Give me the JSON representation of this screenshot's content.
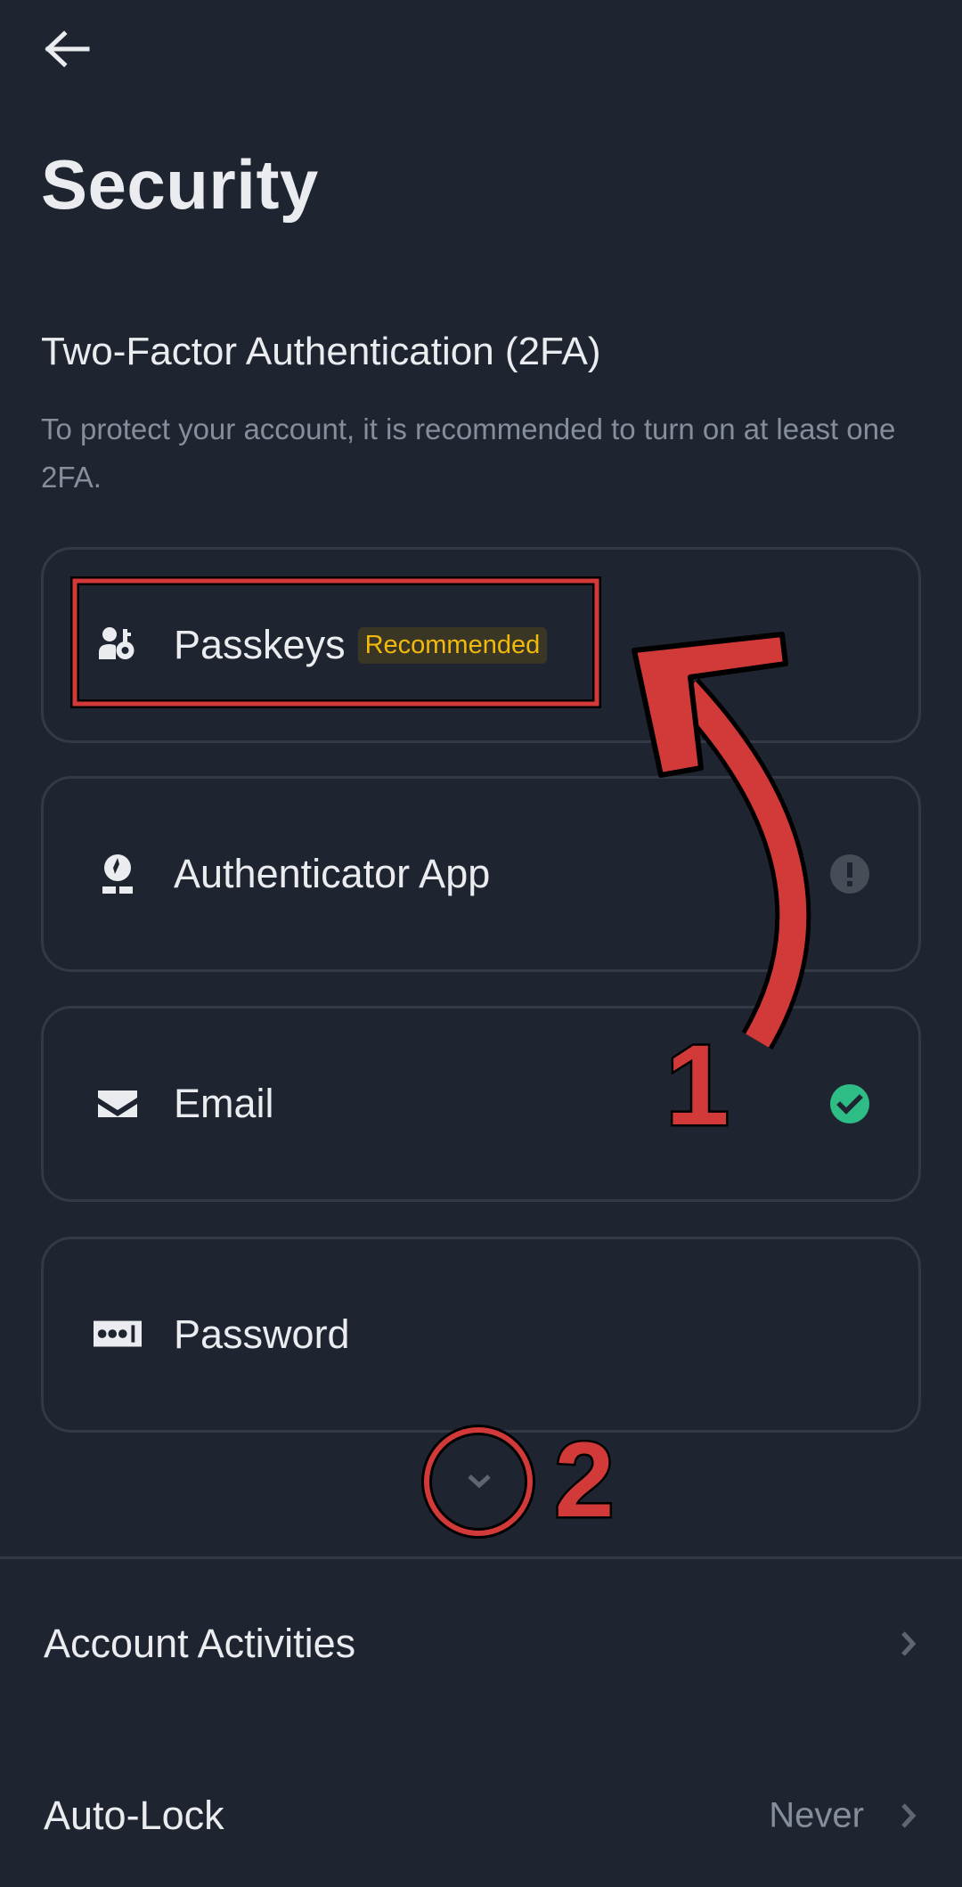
{
  "header": {
    "back_icon": "arrow-left-icon",
    "title": "Security"
  },
  "two_factor": {
    "title": "Two-Factor Authentication (2FA)",
    "description": "To protect your account, it is recommended to turn on at least one 2FA.",
    "methods": [
      {
        "label": "Passkeys",
        "icon": "passkey-icon",
        "badge": "Recommended",
        "status": null
      },
      {
        "label": "Authenticator App",
        "icon": "authenticator-icon",
        "badge": null,
        "status": "warning"
      },
      {
        "label": "Email",
        "icon": "email-icon",
        "badge": null,
        "status": "enabled"
      },
      {
        "label": "Password",
        "icon": "password-icon",
        "badge": null,
        "status": null
      }
    ],
    "expand_icon": "chevron-down-icon"
  },
  "settings": [
    {
      "label": "Account Activities",
      "value": null,
      "icon": "chevron-right-icon"
    },
    {
      "label": "Auto-Lock",
      "value": "Never",
      "icon": "chevron-right-icon"
    }
  ],
  "annotations": {
    "step_1": "1",
    "step_2": "2"
  },
  "colors": {
    "background": "#1f2530",
    "card_border": "#333a46",
    "text_primary": "#eaecef",
    "text_secondary": "#848e9c",
    "badge_text": "#f0b90b",
    "success": "#2ebd85",
    "warning_icon": "#474d57",
    "annotation_red": "#d23a3a"
  }
}
